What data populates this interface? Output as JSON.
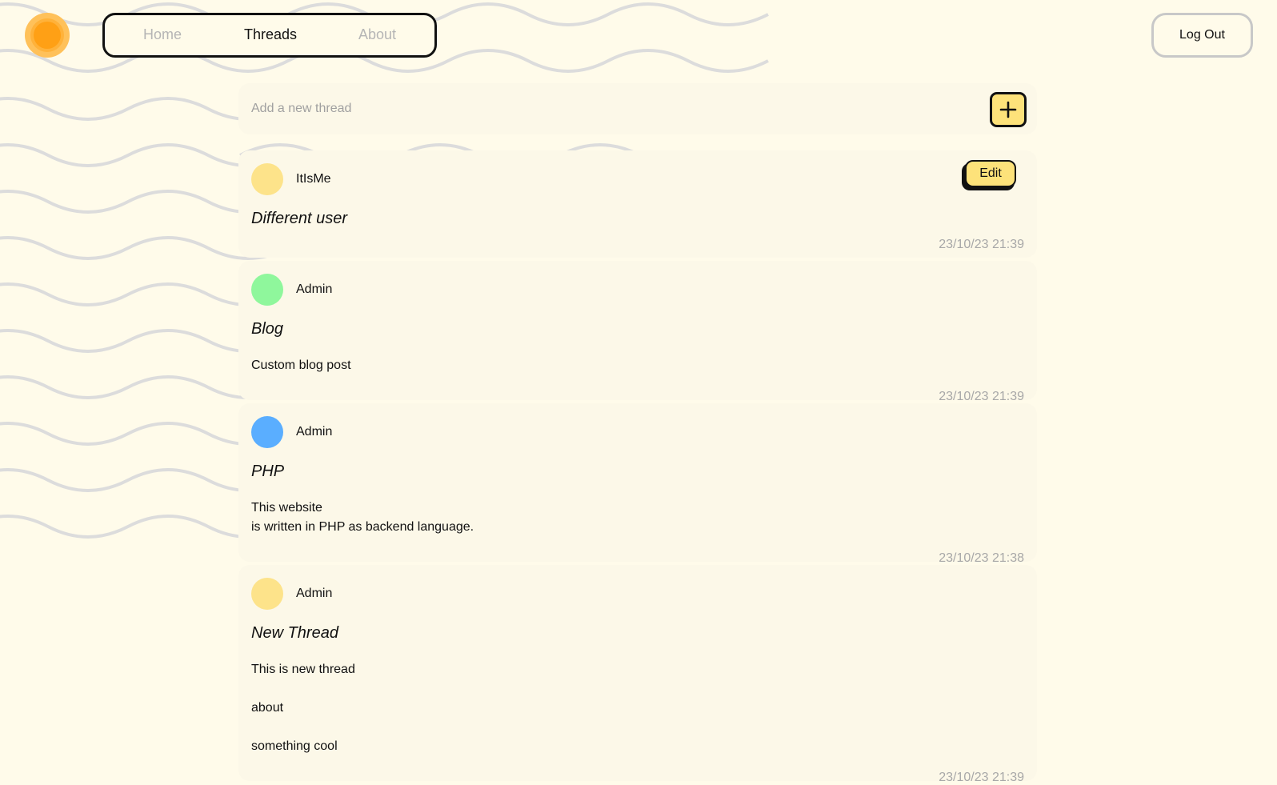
{
  "nav": {
    "items": [
      {
        "label": "Home",
        "active": false
      },
      {
        "label": "Threads",
        "active": true
      },
      {
        "label": "About",
        "active": false
      }
    ]
  },
  "header": {
    "logout_label": "Log Out"
  },
  "new_thread": {
    "placeholder": "Add a new thread",
    "add_icon": "plus-icon"
  },
  "threads": [
    {
      "author": "ItIsMe",
      "avatar_color": "#fde38a",
      "title": "Different user",
      "body": [],
      "timestamp": "23/10/23 21:39",
      "edit_label": "Edit"
    },
    {
      "author": "Admin",
      "avatar_color": "#8ff79c",
      "title": "Blog",
      "body": [
        "Custom blog post"
      ],
      "timestamp": "23/10/23 21:39"
    },
    {
      "author": "Admin",
      "avatar_color": "#5aaeff",
      "title": "PHP",
      "body": [
        "This website",
        "is written in PHP as backend language."
      ],
      "timestamp": "23/10/23 21:38"
    },
    {
      "author": "Admin",
      "avatar_color": "#fde38a",
      "title": "New Thread",
      "body": [
        "This is new thread",
        "about",
        "something cool"
      ],
      "timestamp": "23/10/23 21:39"
    }
  ],
  "colors": {
    "background": "#fffbea",
    "accent": "#fde27a",
    "logo": "#ffa015"
  }
}
